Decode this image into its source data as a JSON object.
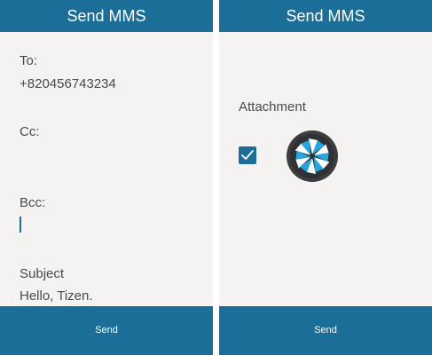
{
  "left_screen": {
    "header_title": "Send MMS",
    "to_label": "To:",
    "to_value": "+820456743234",
    "cc_label": "Cc:",
    "bcc_label": "Bcc:",
    "subject_label": "Subject",
    "subject_value": "Hello, Tizen.",
    "send_label": "Send"
  },
  "right_screen": {
    "header_title": "Send MMS",
    "attachment_label": "Attachment",
    "attachment_checked": true,
    "attachment_icon": "tizen-logo-icon",
    "send_label": "Send"
  },
  "colors": {
    "accent": "#1b6e98",
    "background": "#f4f3f1",
    "text": "#4a4a4a"
  }
}
